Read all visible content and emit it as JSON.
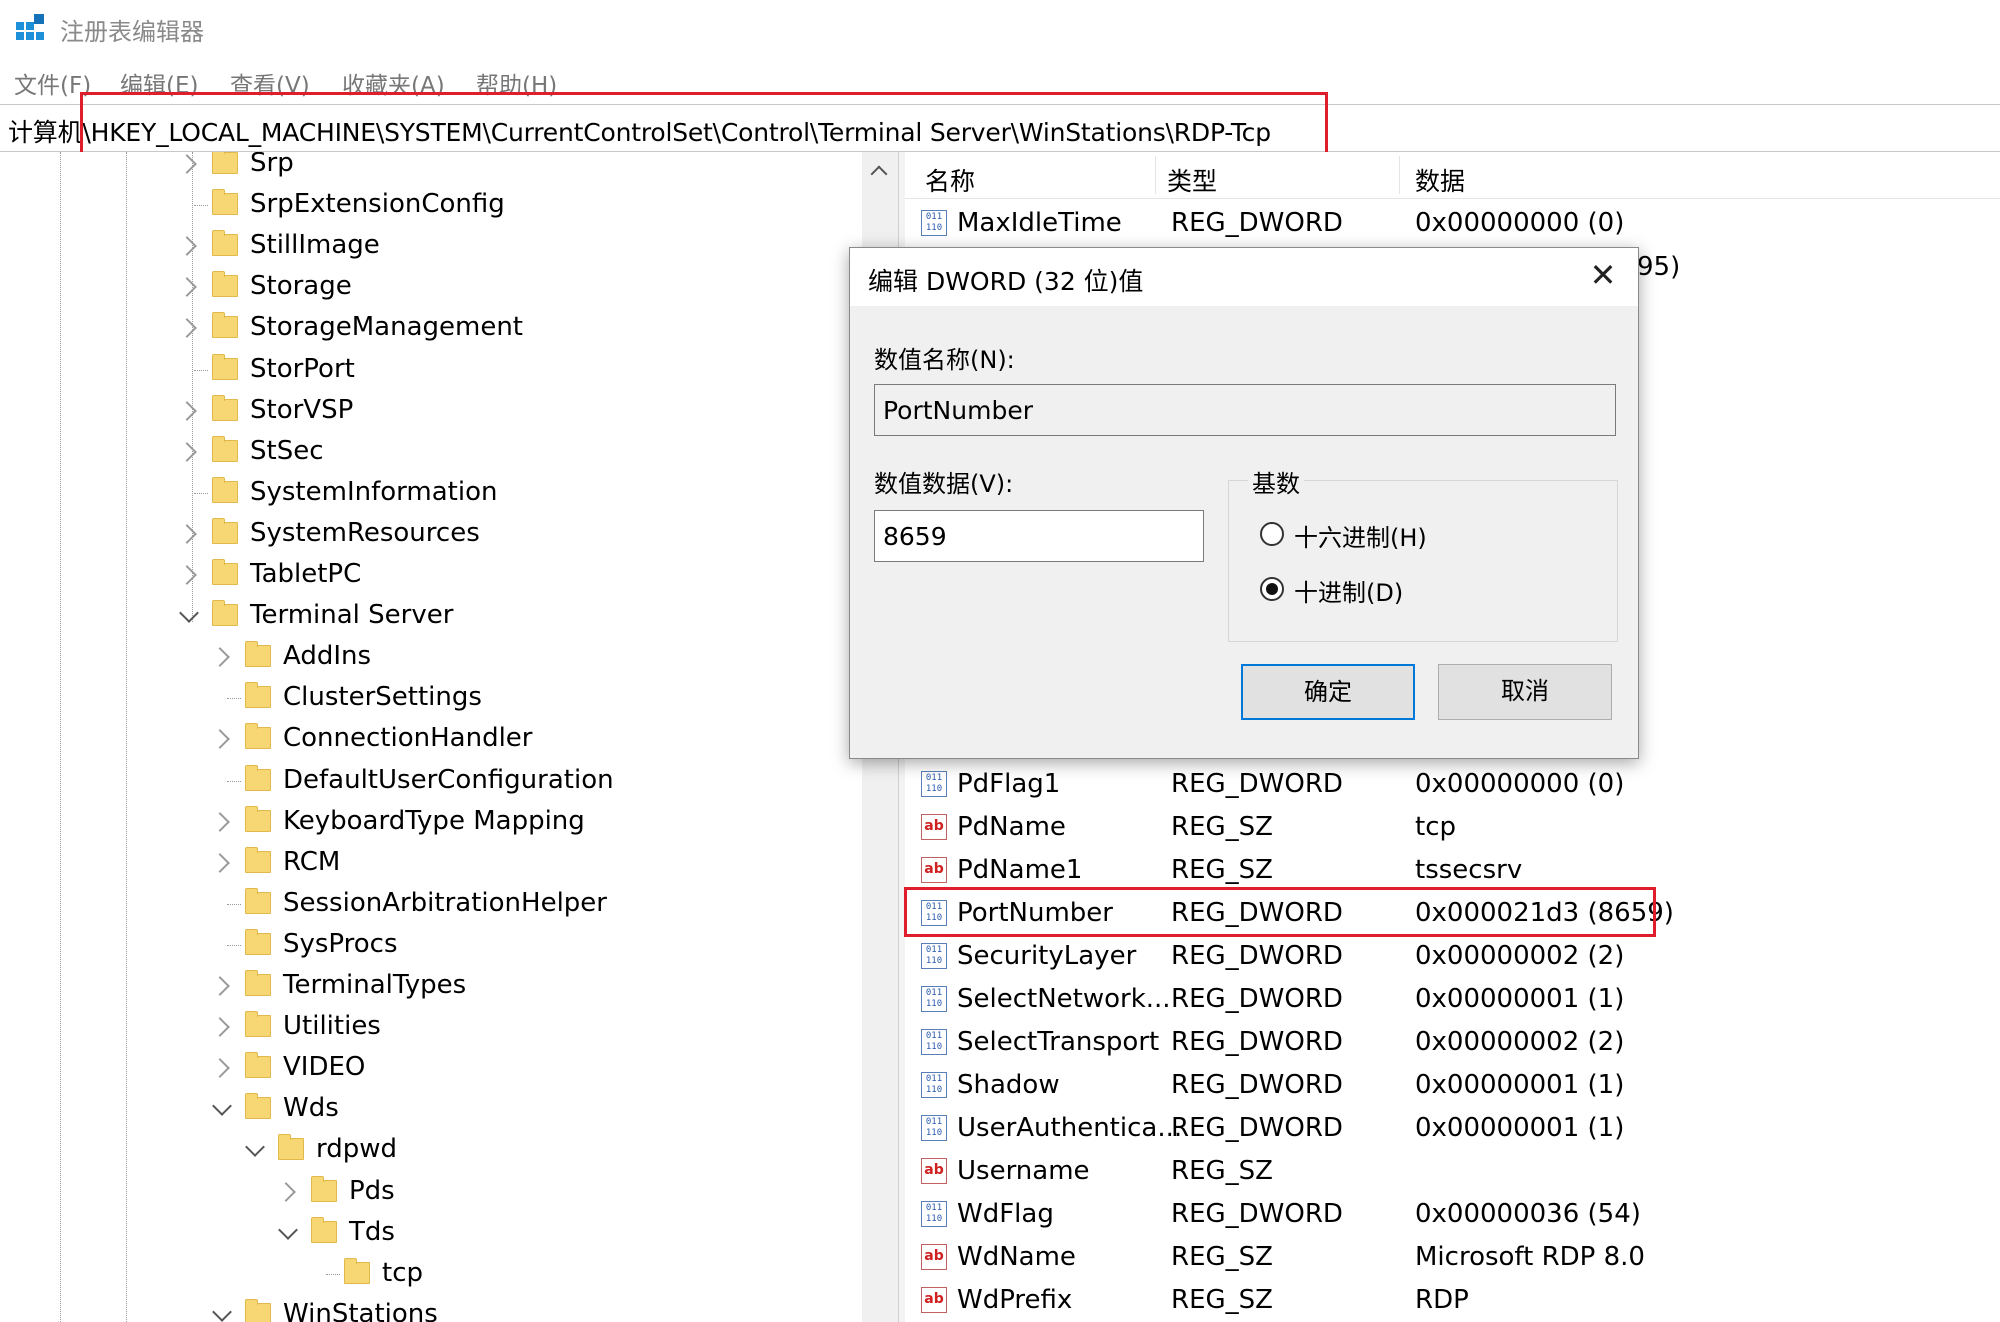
{
  "window": {
    "title": "注册表编辑器"
  },
  "menu": [
    "文件(F)",
    "编辑(E)",
    "查看(V)",
    "收藏夹(A)",
    "帮助(H)"
  ],
  "address": {
    "path": "计算机\\HKEY_LOCAL_MACHINE\\SYSTEM\\CurrentControlSet\\Control\\Terminal Server\\WinStations\\RDP-Tcp"
  },
  "tree": [
    {
      "label": "Srp",
      "level": 0,
      "expander": "collapsed"
    },
    {
      "label": "SrpExtensionConfig",
      "level": 0,
      "expander": "none"
    },
    {
      "label": "StillImage",
      "level": 0,
      "expander": "collapsed"
    },
    {
      "label": "Storage",
      "level": 0,
      "expander": "collapsed"
    },
    {
      "label": "StorageManagement",
      "level": 0,
      "expander": "collapsed"
    },
    {
      "label": "StorPort",
      "level": 0,
      "expander": "none"
    },
    {
      "label": "StorVSP",
      "level": 0,
      "expander": "collapsed"
    },
    {
      "label": "StSec",
      "level": 0,
      "expander": "collapsed"
    },
    {
      "label": "SystemInformation",
      "level": 0,
      "expander": "none"
    },
    {
      "label": "SystemResources",
      "level": 0,
      "expander": "collapsed"
    },
    {
      "label": "TabletPC",
      "level": 0,
      "expander": "collapsed"
    },
    {
      "label": "Terminal Server",
      "level": 0,
      "expander": "expanded"
    },
    {
      "label": "AddIns",
      "level": 1,
      "expander": "collapsed"
    },
    {
      "label": "ClusterSettings",
      "level": 1,
      "expander": "none"
    },
    {
      "label": "ConnectionHandler",
      "level": 1,
      "expander": "collapsed"
    },
    {
      "label": "DefaultUserConfiguration",
      "level": 1,
      "expander": "none"
    },
    {
      "label": "KeyboardType Mapping",
      "level": 1,
      "expander": "collapsed"
    },
    {
      "label": "RCM",
      "level": 1,
      "expander": "collapsed"
    },
    {
      "label": "SessionArbitrationHelper",
      "level": 1,
      "expander": "none"
    },
    {
      "label": "SysProcs",
      "level": 1,
      "expander": "none"
    },
    {
      "label": "TerminalTypes",
      "level": 1,
      "expander": "collapsed"
    },
    {
      "label": "Utilities",
      "level": 1,
      "expander": "collapsed"
    },
    {
      "label": "VIDEO",
      "level": 1,
      "expander": "collapsed"
    },
    {
      "label": "Wds",
      "level": 1,
      "expander": "expanded"
    },
    {
      "label": "rdpwd",
      "level": 2,
      "expander": "expanded"
    },
    {
      "label": "Pds",
      "level": 3,
      "expander": "collapsed"
    },
    {
      "label": "Tds",
      "level": 3,
      "expander": "expanded"
    },
    {
      "label": "tcp",
      "level": 4,
      "expander": "none"
    },
    {
      "label": "WinStations",
      "level": 1,
      "expander": "expanded"
    }
  ],
  "list": {
    "headers": {
      "name": "名称",
      "type": "类型",
      "data": "数据"
    },
    "top_rows": [
      {
        "icon": "binary-value-icon",
        "name": "MaxIdleTime",
        "type": "REG_DWORD",
        "data": "0x00000000 (0)"
      }
    ],
    "partial_visible_data": "95)",
    "rows": [
      {
        "icon": "binary-value-icon",
        "name": "PdFlag1",
        "type": "REG_DWORD",
        "data": "0x00000000 (0)"
      },
      {
        "icon": "string-value-icon",
        "name": "PdName",
        "type": "REG_SZ",
        "data": "tcp"
      },
      {
        "icon": "string-value-icon",
        "name": "PdName1",
        "type": "REG_SZ",
        "data": "tssecsrv"
      },
      {
        "icon": "binary-value-icon",
        "name": "PortNumber",
        "type": "REG_DWORD",
        "data": "0x000021d3 (8659)"
      },
      {
        "icon": "binary-value-icon",
        "name": "SecurityLayer",
        "type": "REG_DWORD",
        "data": "0x00000002 (2)"
      },
      {
        "icon": "binary-value-icon",
        "name": "SelectNetwork...",
        "type": "REG_DWORD",
        "data": "0x00000001 (1)"
      },
      {
        "icon": "binary-value-icon",
        "name": "SelectTransport",
        "type": "REG_DWORD",
        "data": "0x00000002 (2)"
      },
      {
        "icon": "binary-value-icon",
        "name": "Shadow",
        "type": "REG_DWORD",
        "data": "0x00000001 (1)"
      },
      {
        "icon": "binary-value-icon",
        "name": "UserAuthentica...",
        "type": "REG_DWORD",
        "data": "0x00000001 (1)"
      },
      {
        "icon": "string-value-icon",
        "name": "Username",
        "type": "REG_SZ",
        "data": ""
      },
      {
        "icon": "binary-value-icon",
        "name": "WdFlag",
        "type": "REG_DWORD",
        "data": "0x00000036 (54)"
      },
      {
        "icon": "string-value-icon",
        "name": "WdName",
        "type": "REG_SZ",
        "data": "Microsoft RDP 8.0"
      },
      {
        "icon": "string-value-icon",
        "name": "WdPrefix",
        "type": "REG_SZ",
        "data": "RDP"
      }
    ]
  },
  "dialog": {
    "title": "编辑 DWORD (32 位)值",
    "close_glyph": "✕",
    "name_label": "数值名称(N):",
    "name_value": "PortNumber",
    "data_label": "数值数据(V):",
    "data_value": "8659",
    "base_title": "基数",
    "radio_hex": "十六进制(H)",
    "radio_dec": "十进制(D)",
    "selected_base": "dec",
    "ok": "确定",
    "cancel": "取消"
  },
  "colors": {
    "highlight_box": "#e01e2b",
    "folder": "#f7d774",
    "primary_button_border": "#0078d7"
  }
}
